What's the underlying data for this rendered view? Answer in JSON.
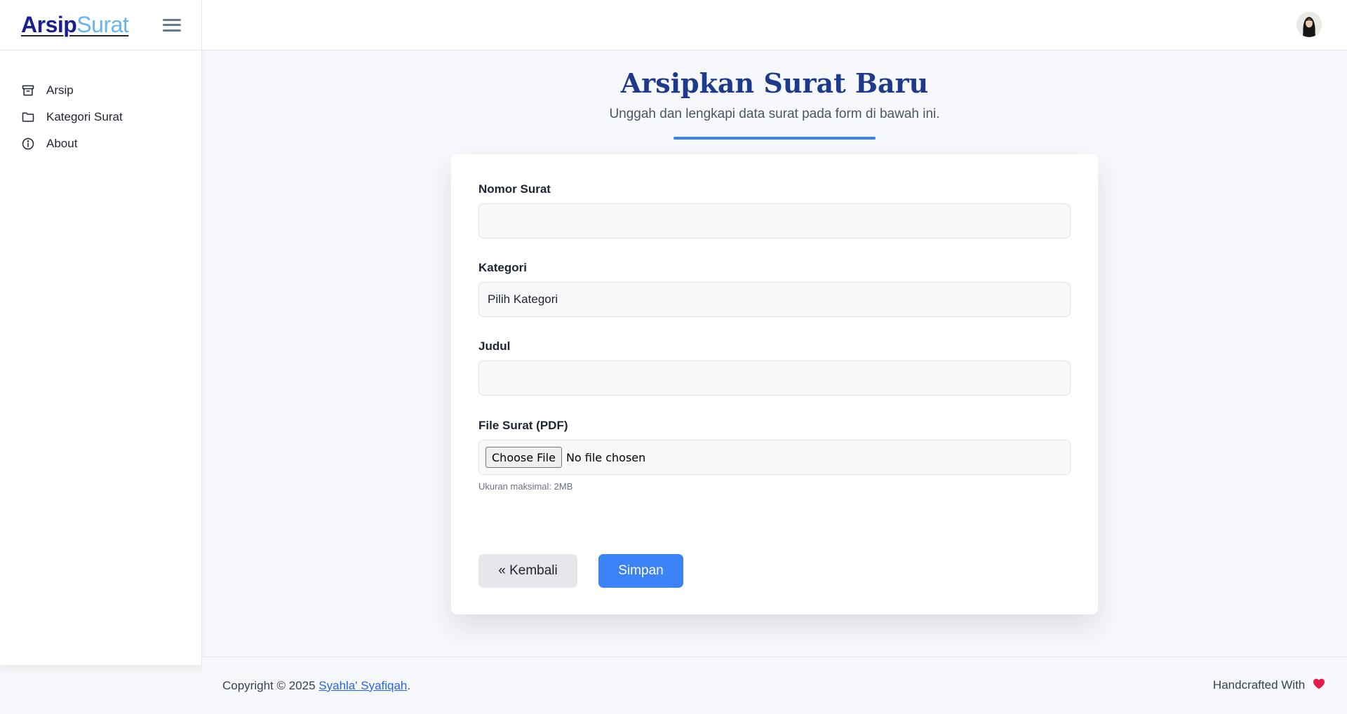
{
  "brand": {
    "part1": "Arsip",
    "part2": "Surat"
  },
  "sidebar": {
    "items": [
      {
        "label": "Arsip",
        "icon": "archive-icon"
      },
      {
        "label": "Kategori Surat",
        "icon": "folder-icon"
      },
      {
        "label": "About",
        "icon": "info-icon"
      }
    ]
  },
  "page": {
    "title": "Arsipkan Surat Baru",
    "subtitle": "Unggah dan lengkapi data surat pada form di bawah ini."
  },
  "form": {
    "nomor_label": "Nomor Surat",
    "nomor_value": "",
    "kategori_label": "Kategori",
    "kategori_value": "Pilih Kategori",
    "judul_label": "Judul",
    "judul_value": "",
    "file_label": "File Surat (PDF)",
    "file_button": "Choose File",
    "file_status": "No file chosen",
    "file_hint": "Ukuran maksimal: 2MB",
    "back_label": "« Kembali",
    "save_label": "Simpan"
  },
  "footer": {
    "copyright_prefix": "Copyright © 2025 ",
    "author": "Syahla' Syafiqah",
    "copyright_suffix": ".",
    "handcrafted": "Handcrafted With"
  },
  "colors": {
    "accent": "#3b82f6",
    "title": "#1e3a8a",
    "brand_dark": "#1a1f8f",
    "brand_light": "#67b4f0",
    "heart": "#e11d48"
  }
}
